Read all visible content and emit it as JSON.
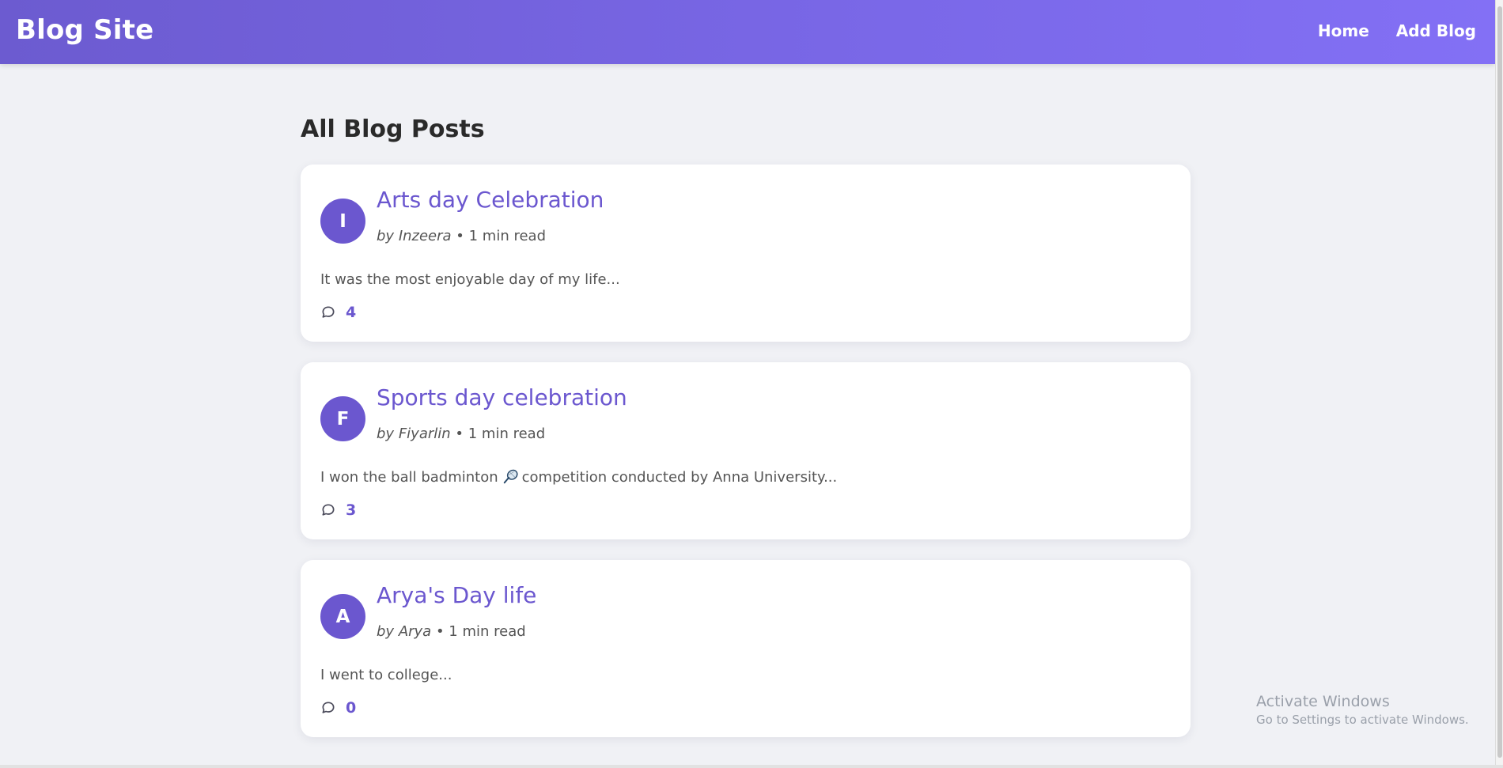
{
  "navbar": {
    "brand": "Blog Site",
    "links": [
      "Home",
      "Add Blog"
    ],
    "gradient_start": "#6c5bd0",
    "gradient_end": "#8370f5"
  },
  "main": {
    "title": "All Blog Posts",
    "posts": [
      {
        "avatar_letter": "I",
        "title": "Arts day Celebration",
        "by_prefix": "by",
        "author": "Inzeera",
        "read_time": "• 1 min read",
        "excerpt_before": "It was the most enjoyable day of my life...",
        "excerpt_after": "",
        "comment_icon": "comment-bubble-icon",
        "comments": "4"
      },
      {
        "avatar_letter": "F",
        "title": "Sports day celebration",
        "by_prefix": "by",
        "author": "Fiyarlin",
        "read_time": "• 1 min read",
        "excerpt_before": "I won the ball badminton",
        "excerpt_icon": "badminton-racket-icon",
        "excerpt_after": "competition conducted by Anna University...",
        "comment_icon": "comment-bubble-icon",
        "comments": "3"
      },
      {
        "avatar_letter": "A",
        "title": "Arya's Day life",
        "by_prefix": "by",
        "author": "Arya",
        "read_time": "• 1 min read",
        "excerpt_before": "I went to college...",
        "excerpt_after": "",
        "comment_icon": "comment-bubble-icon",
        "comments": "0"
      }
    ]
  },
  "watermark": {
    "line1": "Activate Windows",
    "line2": "Go to Settings to activate Windows."
  },
  "colors": {
    "accent": "#6b57cf",
    "background": "#f0f1f5",
    "card": "#ffffff"
  }
}
